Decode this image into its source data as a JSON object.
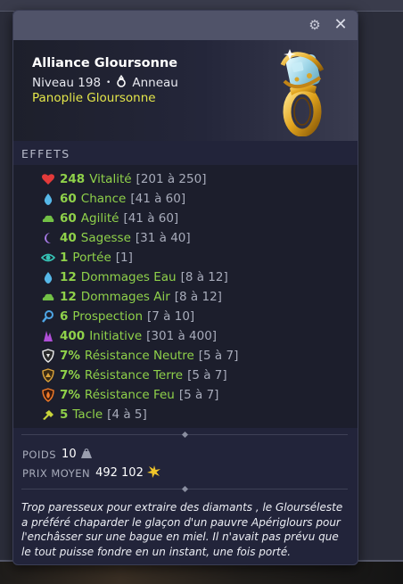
{
  "item": {
    "name": "Alliance Gloursonne",
    "level": "Niveau 198",
    "type_separator": "•",
    "type": "Anneau",
    "panoply": "Panoplie Gloursonne"
  },
  "sections": {
    "effects_title": "EFFETS"
  },
  "effects": [
    {
      "icon": "heart-icon",
      "value": "248",
      "name": "Vitalité",
      "range": "[201 à 250]"
    },
    {
      "icon": "water-drop-icon",
      "value": "60",
      "name": "Chance",
      "range": "[41 à 60]"
    },
    {
      "icon": "cloud-icon",
      "value": "60",
      "name": "Agilité",
      "range": "[41 à 60]"
    },
    {
      "icon": "moon-icon",
      "value": "40",
      "name": "Sagesse",
      "range": "[31 à 40]"
    },
    {
      "icon": "eye-icon",
      "value": "1",
      "name": "Portée",
      "range": "[1]"
    },
    {
      "icon": "water-drop-icon",
      "value": "12",
      "name": "Dommages Eau",
      "range": "[8 à 12]"
    },
    {
      "icon": "cloud-icon",
      "value": "12",
      "name": "Dommages Air",
      "range": "[8 à 12]"
    },
    {
      "icon": "magnifier-icon",
      "value": "6",
      "name": "Prospection",
      "range": "[7 à 10]"
    },
    {
      "icon": "initiative-icon",
      "value": "400",
      "name": "Initiative",
      "range": "[301 à 400]"
    },
    {
      "icon": "neutral-shield-icon",
      "value": "7%",
      "name": "Résistance Neutre",
      "range": "[5 à 7]"
    },
    {
      "icon": "earth-shield-icon",
      "value": "7%",
      "name": "Résistance Terre",
      "range": "[5 à 7]"
    },
    {
      "icon": "fire-shield-icon",
      "value": "7%",
      "name": "Résistance Feu",
      "range": "[5 à 7]"
    },
    {
      "icon": "tackle-icon",
      "value": "5",
      "name": "Tacle",
      "range": "[4 à 5]"
    }
  ],
  "meta": {
    "weight_label": "POIDS",
    "weight_value": "10",
    "price_label": "PRIX MOYEN",
    "price_value": "492 102"
  },
  "description": "Trop paresseux pour extraire des diamants , le Glourséleste a préféré chaparder le glaçon d'un pauvre Apériglours pour l'enchâsser sur une bague en miel. Il n'avait pas prévu que le tout puisse fondre en un instant, une fois porté.",
  "colors": {
    "effect_green": "#8fd14a",
    "panoply_yellow": "#e4e64a",
    "range_grey": "#a8acbb"
  }
}
